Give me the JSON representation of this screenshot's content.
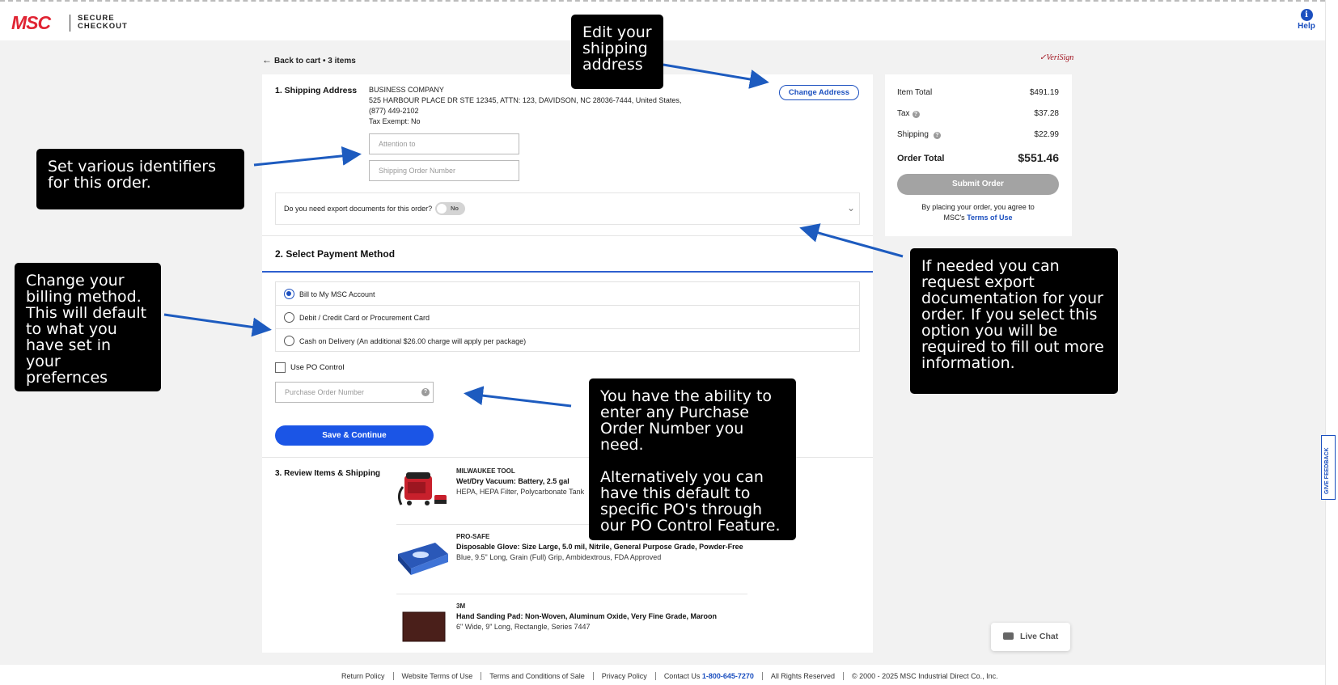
{
  "header": {
    "logo_text": "MSC",
    "secure_line1": "SECURE",
    "secure_line2": "CHECKOUT",
    "help_label": "Help",
    "help_icon": "i"
  },
  "back_link": "Back to cart • 3 items",
  "verisign": "VeriSign",
  "shipping": {
    "heading": "1. Shipping Address",
    "company": "BUSINESS COMPANY",
    "address": "525 HARBOUR PLACE DR STE 12345, ATTN: 123, DAVIDSON, NC 28036-7444, United States,",
    "phone": "(877) 449-2102",
    "tax": "Tax Exempt: No",
    "change_button": "Change Address",
    "attention_placeholder": "Attention to",
    "order_number_placeholder": "Shipping Order Number",
    "export_question": "Do you need export documents for this order?",
    "export_toggle": "No"
  },
  "payment": {
    "heading": "2. Select Payment Method",
    "options": [
      {
        "label": "Bill to My MSC Account",
        "selected": true
      },
      {
        "label": "Debit / Credit Card or Procurement Card",
        "selected": false
      },
      {
        "label": "Cash on Delivery (An additional $26.00 charge will apply per package)",
        "selected": false
      }
    ],
    "po_control_label": "Use PO Control",
    "po_placeholder": "Purchase Order Number",
    "save_button": "Save & Continue"
  },
  "review": {
    "heading": "3. Review Items & Shipping",
    "items": [
      {
        "brand": "MILWAUKEE TOOL",
        "name": "Wet/Dry Vacuum: Battery, 2.5 gal",
        "desc": "HEPA, HEPA Filter, Polycarbonate Tank"
      },
      {
        "brand": "PRO-SAFE",
        "name": "Disposable Glove: Size Large, 5.0 mil, Nitrile, General Purpose Grade, Powder-Free",
        "desc": "Blue, 9.5\" Long, Grain (Full) Grip, Ambidextrous, FDA Approved"
      },
      {
        "brand": "3M",
        "name": "Hand Sanding Pad: Non-Woven, Aluminum Oxide, Very Fine Grade, Maroon",
        "desc": "6\" Wide, 9\" Long, Rectangle, Series 7447"
      }
    ]
  },
  "summary": {
    "item_total_label": "Item Total",
    "item_total": "$491.19",
    "tax_label": "Tax",
    "tax": "$37.28",
    "shipping_label": "Shipping",
    "shipping": "$22.99",
    "order_total_label": "Order Total",
    "order_total": "$551.46",
    "submit_button": "Submit Order",
    "agree_text": "By placing your order, you agree to",
    "agree_prefix": "MSC's",
    "terms_link": "Terms of Use",
    "info_icon": "?"
  },
  "live_chat": "Live Chat",
  "feedback": "GIVE FEEDBACK",
  "footer": {
    "links": [
      "Return Policy",
      "Website Terms of Use",
      "Terms and Conditions of Sale",
      "Privacy Policy"
    ],
    "contact_prefix": "Contact Us",
    "phone": "1-800-645-7270",
    "rights": "All Rights Reserved",
    "copyright": "© 2000 - 2025 MSC Industrial Direct Co., Inc."
  },
  "callouts": {
    "edit_address": "Edit your\nshipping\naddress",
    "identifiers": "Set various identifiers\nfor this order.",
    "billing": "Change your\nbilling method.\nThis will default\nto what you\nhave set in your\nprefernces",
    "export": "If needed you can\nrequest export\ndocumentation for your\norder.  If you select this\noption you will be\nrequired to fill out more\ninformation.",
    "po": "You have the ability to\nenter any Purchase\nOrder Number you need.\n\nAlternatively you can\nhave this default to\nspecific PO's through\nour PO Control Feature."
  },
  "colors": {
    "brand_red": "#e02433",
    "accent_blue": "#1b55e6",
    "link_blue": "#1b4fbf",
    "arrow_blue": "#1d5bbf"
  }
}
